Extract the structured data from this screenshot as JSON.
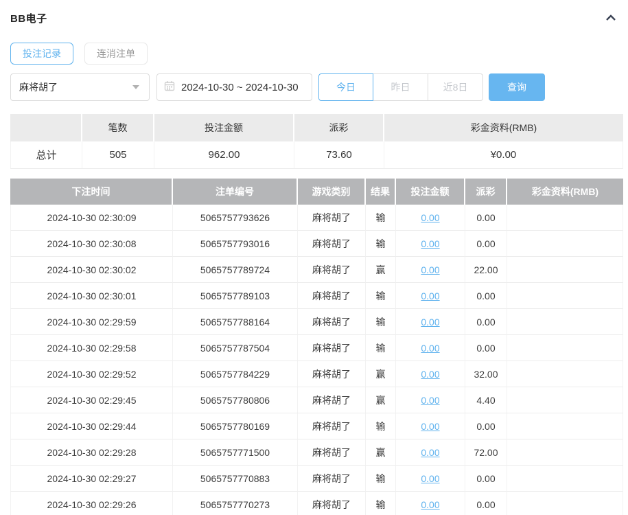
{
  "panel": {
    "title": "BB电子"
  },
  "tabs": [
    {
      "label": "投注记录",
      "active": true
    },
    {
      "label": "连消注单",
      "active": false
    }
  ],
  "filters": {
    "game_select": {
      "value": "麻将胡了"
    },
    "date_range": {
      "value": "2024-10-30 ~ 2024-10-30"
    },
    "quick_ranges": [
      {
        "label": "今日",
        "active": true
      },
      {
        "label": "昨日",
        "active": false
      },
      {
        "label": "近8日",
        "active": false
      }
    ],
    "query_label": "查询"
  },
  "summary": {
    "columns": [
      "",
      "笔数",
      "投注金额",
      "派彩",
      "彩金资料(RMB)"
    ],
    "total": {
      "label": "总计",
      "count": "505",
      "bet_amount": "962.00",
      "payout": "73.60",
      "bonus": "¥0.00"
    }
  },
  "records": {
    "columns": [
      "下注时间",
      "注单编号",
      "游戏类别",
      "结果",
      "投注金额",
      "派彩",
      "彩金资料(RMB)"
    ],
    "rows": [
      {
        "time": "2024-10-30 02:30:09",
        "order": "5065757793626",
        "game": "麻将胡了",
        "result": "输",
        "bet": "0.00",
        "payout": "0.00",
        "bonus": ""
      },
      {
        "time": "2024-10-30 02:30:08",
        "order": "5065757793016",
        "game": "麻将胡了",
        "result": "输",
        "bet": "0.00",
        "payout": "0.00",
        "bonus": ""
      },
      {
        "time": "2024-10-30 02:30:02",
        "order": "5065757789724",
        "game": "麻将胡了",
        "result": "赢",
        "bet": "0.00",
        "payout": "22.00",
        "bonus": ""
      },
      {
        "time": "2024-10-30 02:30:01",
        "order": "5065757789103",
        "game": "麻将胡了",
        "result": "输",
        "bet": "0.00",
        "payout": "0.00",
        "bonus": ""
      },
      {
        "time": "2024-10-30 02:29:59",
        "order": "5065757788164",
        "game": "麻将胡了",
        "result": "输",
        "bet": "0.00",
        "payout": "0.00",
        "bonus": ""
      },
      {
        "time": "2024-10-30 02:29:58",
        "order": "5065757787504",
        "game": "麻将胡了",
        "result": "输",
        "bet": "0.00",
        "payout": "0.00",
        "bonus": ""
      },
      {
        "time": "2024-10-30 02:29:52",
        "order": "5065757784229",
        "game": "麻将胡了",
        "result": "赢",
        "bet": "0.00",
        "payout": "32.00",
        "bonus": ""
      },
      {
        "time": "2024-10-30 02:29:45",
        "order": "5065757780806",
        "game": "麻将胡了",
        "result": "赢",
        "bet": "0.00",
        "payout": "4.40",
        "bonus": ""
      },
      {
        "time": "2024-10-30 02:29:44",
        "order": "5065757780169",
        "game": "麻将胡了",
        "result": "输",
        "bet": "0.00",
        "payout": "0.00",
        "bonus": ""
      },
      {
        "time": "2024-10-30 02:29:28",
        "order": "5065757771500",
        "game": "麻将胡了",
        "result": "赢",
        "bet": "0.00",
        "payout": "72.00",
        "bonus": ""
      },
      {
        "time": "2024-10-30 02:29:27",
        "order": "5065757770883",
        "game": "麻将胡了",
        "result": "输",
        "bet": "0.00",
        "payout": "0.00",
        "bonus": ""
      },
      {
        "time": "2024-10-30 02:29:26",
        "order": "5065757770273",
        "game": "麻将胡了",
        "result": "输",
        "bet": "0.00",
        "payout": "0.00",
        "bonus": ""
      }
    ]
  },
  "colors": {
    "accent": "#5fb2ee",
    "query_button_bg": "#67b6f0",
    "table_header_bg": "#b5b6b8",
    "summary_header_bg": "#ebebeb",
    "border": "#ececec"
  }
}
